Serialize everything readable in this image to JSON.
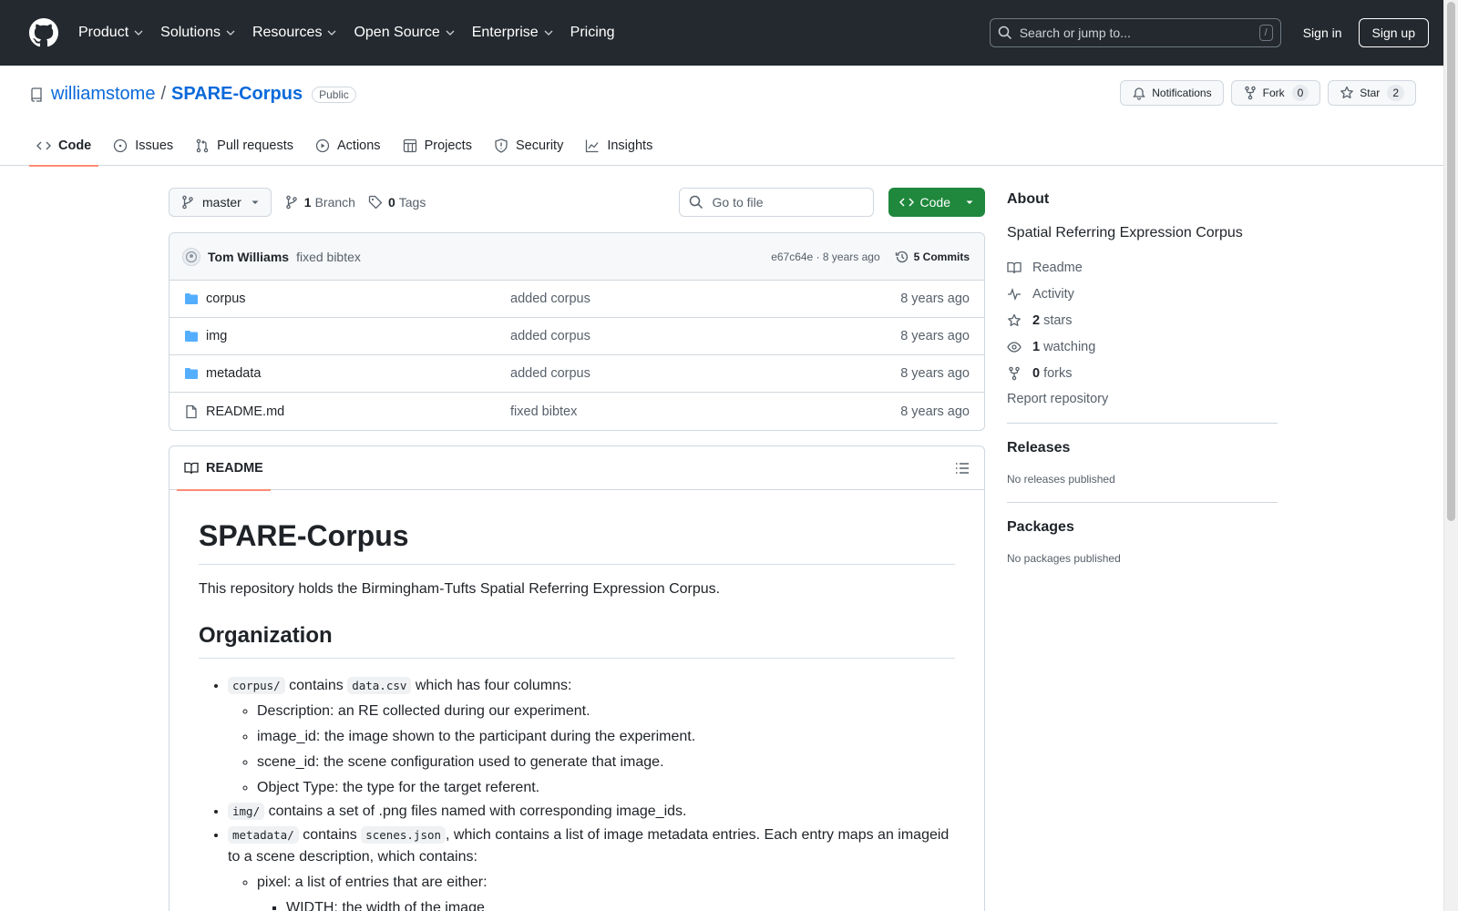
{
  "header": {
    "nav": [
      {
        "label": "Product",
        "dropdown": true
      },
      {
        "label": "Solutions",
        "dropdown": true
      },
      {
        "label": "Resources",
        "dropdown": true
      },
      {
        "label": "Open Source",
        "dropdown": true
      },
      {
        "label": "Enterprise",
        "dropdown": true
      },
      {
        "label": "Pricing",
        "dropdown": false
      }
    ],
    "search_placeholder": "Search or jump to...",
    "search_shortcut": "/",
    "sign_in": "Sign in",
    "sign_up": "Sign up"
  },
  "repo": {
    "owner": "williamstome",
    "separator": "/",
    "name": "SPARE-Corpus",
    "visibility": "Public",
    "notifications_label": "Notifications",
    "fork_label": "Fork",
    "fork_count": "0",
    "star_label": "Star",
    "star_count": "2",
    "tabs": [
      {
        "label": "Code",
        "icon": "code-icon",
        "active": true
      },
      {
        "label": "Issues",
        "icon": "issue-icon",
        "active": false
      },
      {
        "label": "Pull requests",
        "icon": "pull-request-icon",
        "active": false
      },
      {
        "label": "Actions",
        "icon": "actions-icon",
        "active": false
      },
      {
        "label": "Projects",
        "icon": "projects-icon",
        "active": false
      },
      {
        "label": "Security",
        "icon": "shield-icon",
        "active": false
      },
      {
        "label": "Insights",
        "icon": "graph-icon",
        "active": false
      }
    ]
  },
  "toolbar": {
    "branch": "master",
    "branch_count": "1",
    "branch_label": "Branch",
    "tag_count": "0",
    "tag_label": "Tags",
    "goto_file": "Go to file",
    "code_button": "Code"
  },
  "commit": {
    "author": "Tom Williams",
    "message": "fixed bibtex",
    "hash": "e67c64e",
    "dot": "·",
    "age": "8 years ago",
    "commits_label": "5 Commits"
  },
  "files": [
    {
      "name": "corpus",
      "type": "folder",
      "message": "added corpus",
      "age": "8 years ago"
    },
    {
      "name": "img",
      "type": "folder",
      "message": "added corpus",
      "age": "8 years ago"
    },
    {
      "name": "metadata",
      "type": "folder",
      "message": "added corpus",
      "age": "8 years ago"
    },
    {
      "name": "README.md",
      "type": "file",
      "message": "fixed bibtex",
      "age": "8 years ago"
    }
  ],
  "readme": {
    "tab_label": "README",
    "h1": "SPARE-Corpus",
    "intro": "This repository holds the Birmingham-Tufts Spatial Referring Expression Corpus.",
    "h2": "Organization",
    "item1_code1": "corpus/",
    "item1_text1": "contains",
    "item1_code2": "data.csv",
    "item1_text2": "which has four columns:",
    "item1_sub": [
      "Description: an RE collected during our experiment.",
      "image_id: the image shown to the participant during the experiment.",
      "scene_id: the scene configuration used to generate that image.",
      "Object Type: the type for the target referent."
    ],
    "item2_code": "img/",
    "item2_text": "contains a set of .png files named with corresponding image_ids.",
    "item3_code1": "metadata/",
    "item3_text1": "contains",
    "item3_code2": "scenes.json",
    "item3_text2": ", which contains a list of image metadata entries. Each entry maps an imageid to a scene description, which contains:",
    "item3_sub1": "pixel: a list of entries that are either:",
    "item3_subsub1": "WIDTH: the width of the image"
  },
  "sidebar": {
    "about_heading": "About",
    "description": "Spatial Referring Expression Corpus",
    "readme_link": "Readme",
    "activity_link": "Activity",
    "stars_count": "2",
    "stars_label": "stars",
    "watching_count": "1",
    "watching_label": "watching",
    "forks_count": "0",
    "forks_label": "forks",
    "report": "Report repository",
    "releases_heading": "Releases",
    "releases_text": "No releases published",
    "packages_heading": "Packages",
    "packages_text": "No packages published"
  },
  "colors": {
    "header_bg": "#24292f",
    "link": "#0969da",
    "code_button": "#1f883d",
    "active_tab_underline": "#fd8c73",
    "folder": "#54aeff"
  }
}
